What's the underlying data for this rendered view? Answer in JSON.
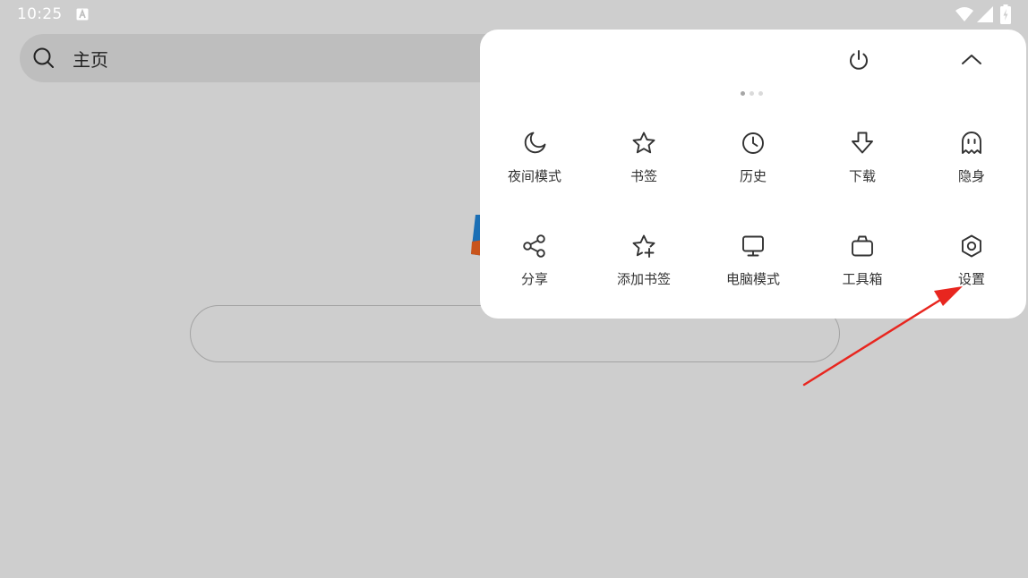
{
  "status_bar": {
    "time": "10:25",
    "notification_icon": "a-notification-icon",
    "wifi_icon": "wifi-icon",
    "signal_icon": "signal-icon",
    "battery_icon": "battery-charging-icon"
  },
  "search_bar": {
    "icon": "search-icon",
    "title": "主页"
  },
  "menu": {
    "power_icon": "power-icon",
    "collapse_icon": "chevron-up-icon",
    "page_count": 3,
    "active_page": 1,
    "items": [
      {
        "label": "夜间模式",
        "icon": "moon-icon"
      },
      {
        "label": "书签",
        "icon": "star-icon"
      },
      {
        "label": "历史",
        "icon": "clock-icon"
      },
      {
        "label": "下载",
        "icon": "download-arrow-icon"
      },
      {
        "label": "隐身",
        "icon": "ghost-icon"
      },
      {
        "label": "分享",
        "icon": "share-icon"
      },
      {
        "label": "添加书签",
        "icon": "star-plus-icon"
      },
      {
        "label": "电脑模式",
        "icon": "monitor-icon"
      },
      {
        "label": "工具箱",
        "icon": "toolbox-icon"
      },
      {
        "label": "设置",
        "icon": "settings-hexagon-icon"
      }
    ]
  },
  "colors": {
    "backdrop": "#cecece",
    "panel": "#ffffff",
    "icon_stroke": "#333333",
    "annotation_arrow": "#e8261f"
  }
}
